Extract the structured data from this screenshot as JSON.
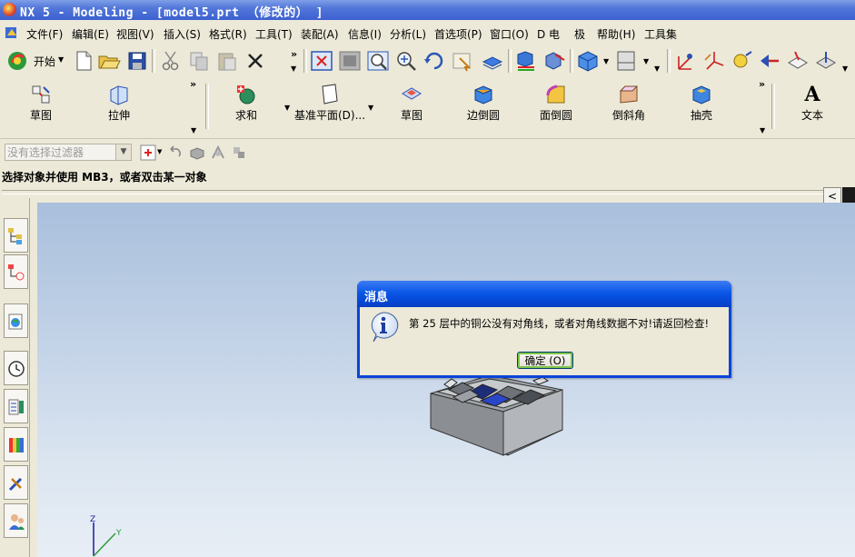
{
  "window": {
    "title": "NX 5 - Modeling - [model5.prt （修改的） ]"
  },
  "menubar": {
    "items": [
      "文件(F)",
      "编辑(E)",
      "视图(V)",
      "插入(S)",
      "格式(R)",
      "工具(T)",
      "装配(A)",
      "信息(I)",
      "分析(L)",
      "首选项(P)",
      "窗口(O)",
      "D 电",
      "极",
      "帮助(H)",
      "工具集"
    ]
  },
  "standard_toolbar": {
    "start_label": "开始",
    "icons": [
      "new-icon",
      "open-icon",
      "save-icon",
      "cut-icon",
      "copy-icon",
      "paste-icon",
      "delete-icon",
      "fit-icon",
      "zoom-window-icon",
      "zoom-icon",
      "zoom-in-icon",
      "rotate-icon",
      "pan-icon",
      "layer-icon",
      "render-style-icon",
      "orient-view-icon",
      "wcs-icon",
      "snap-icon",
      "datum-icon"
    ]
  },
  "feature_toolbar": {
    "buttons": [
      {
        "label": "草图",
        "icon": "sketch-icon"
      },
      {
        "label": "拉伸",
        "icon": "extrude-icon"
      },
      {
        "label": "求和",
        "icon": "unite-icon"
      },
      {
        "label": "基准平面(D)...",
        "icon": "datum-plane-icon"
      },
      {
        "label": "草图",
        "icon": "sketch-section-icon"
      },
      {
        "label": "边倒圆",
        "icon": "edge-blend-icon"
      },
      {
        "label": "面倒圆",
        "icon": "face-blend-icon"
      },
      {
        "label": "倒斜角",
        "icon": "chamfer-icon"
      },
      {
        "label": "抽壳",
        "icon": "shell-icon"
      },
      {
        "label": "文本",
        "icon": "text-icon"
      }
    ]
  },
  "selection_bar": {
    "filter_placeholder": "没有选择过滤器"
  },
  "cue_line": {
    "text": "选择对象并使用 MB3，或者双击某一对象"
  },
  "dialog": {
    "title": "消息",
    "message": "第 25 层中的铜公没有对角线，或者对角线数据不对!请返回检查!",
    "ok_label": "确定 (O)"
  },
  "triad": {
    "z_label": "Z",
    "y_label": "Y"
  },
  "colors": {
    "title_bar": "#3b60d0",
    "dialog_title": "#0a57e6",
    "viewport_top": "#a9bfdc",
    "viewport_bottom": "#e8eef5"
  }
}
